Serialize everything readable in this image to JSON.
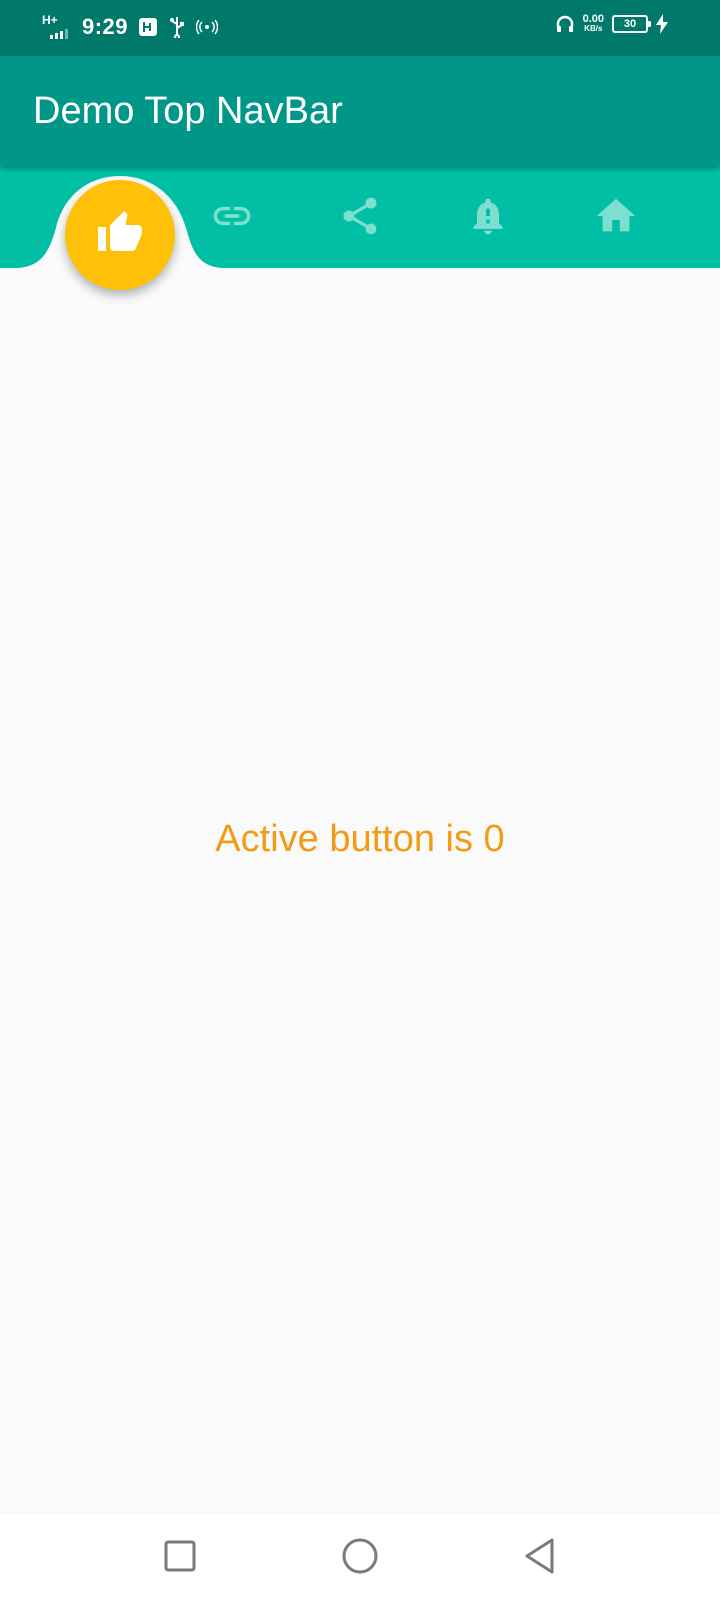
{
  "status_bar": {
    "network_type": "H+",
    "time": "9:29",
    "speed_value": "0.00",
    "speed_unit": "KB/s",
    "battery_level": "30",
    "icons": [
      "signal-icon",
      "usb-debug-icon",
      "usb-icon",
      "hotspot-icon",
      "headphones-icon",
      "battery-icon",
      "charging-icon"
    ]
  },
  "app_bar": {
    "title": "Demo Top NavBar"
  },
  "nav": {
    "active_index": 0,
    "items": [
      {
        "icon": "thumb-up-icon",
        "active": true
      },
      {
        "icon": "link-icon",
        "active": false
      },
      {
        "icon": "share-icon",
        "active": false
      },
      {
        "icon": "notification-important-icon",
        "active": false
      },
      {
        "icon": "home-icon",
        "active": false
      }
    ]
  },
  "main": {
    "status_text": "Active button is 0"
  },
  "system_nav": {
    "buttons": [
      "recents-button",
      "home-button",
      "back-button"
    ]
  },
  "colors": {
    "status_bar": "#00796b",
    "app_bar": "#009688",
    "nav_bar": "#00bfa5",
    "nav_icon": "#7ddfce",
    "fab": "#ffc107",
    "accent_text": "#f29b16",
    "background": "#fafafa"
  }
}
